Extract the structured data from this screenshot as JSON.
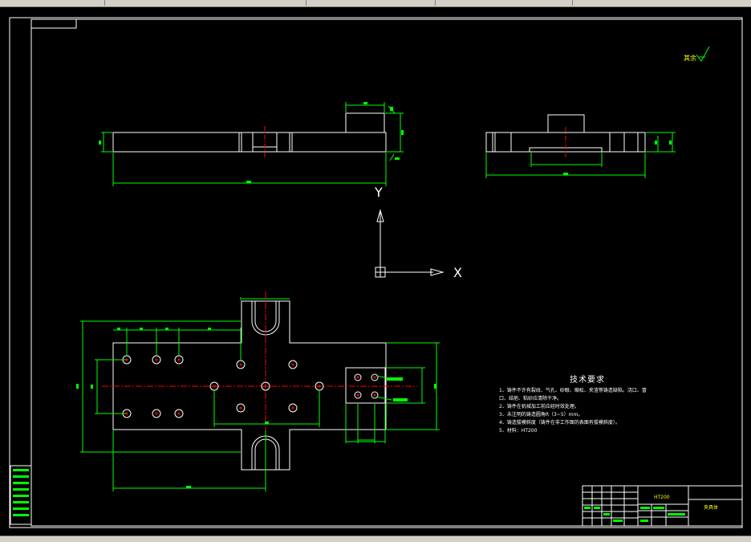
{
  "drawing": {
    "roughness_note": "其余",
    "axis_y": "Y",
    "axis_x": "X",
    "title_block_material": "HT200",
    "title_block_name": "夹具体"
  },
  "tech_requirements": {
    "heading": "技术要求",
    "lines": [
      "1、铸件不许有裂纹、气孔、砂眼、缩松、夹渣等铸造缺陷。浇口、冒",
      "口、结疤、粘砂应清除干净。",
      "2、铸件在机械加工前应经时效处理。",
      "3、未注明的铸造圆角R（3~5）mm。",
      "4、铸造拔模斜度（铸件在非工作面的表面有拔模斜度）。",
      "5、材料：HT200"
    ]
  },
  "colors": {
    "background": "#000000",
    "outline": "#ffffff",
    "dimension": "#00ff00",
    "centerline": "#ff0000",
    "label": "#ffff00"
  }
}
